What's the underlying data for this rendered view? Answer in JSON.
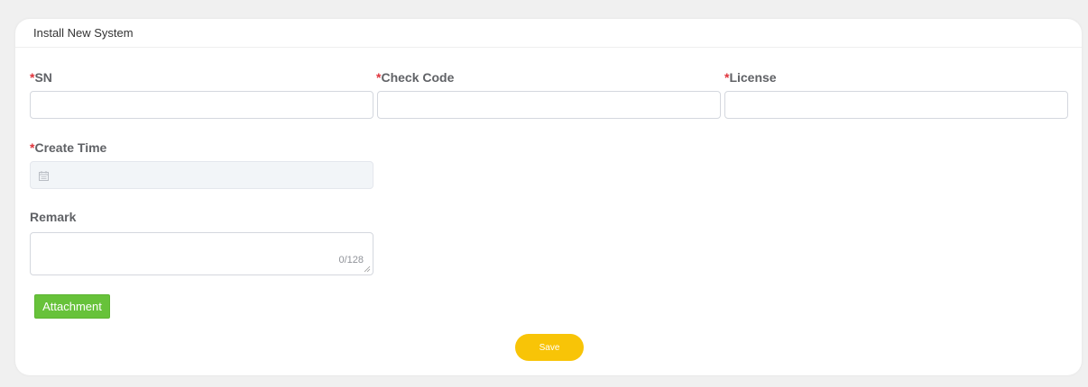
{
  "form": {
    "title": "Install New System",
    "required_mark": "*",
    "fields": {
      "sn": {
        "label": "SN",
        "value": ""
      },
      "check_code": {
        "label": "Check Code",
        "value": ""
      },
      "license": {
        "label": "License",
        "value": ""
      },
      "create_time": {
        "label": "Create Time",
        "value": "",
        "icon": "calendar-icon"
      },
      "remark": {
        "label": "Remark",
        "value": "",
        "counter": "0/128"
      }
    },
    "attachment_label": "Attachment",
    "save_label": "Save"
  },
  "colors": {
    "required": "#e0343c",
    "attachment": "#67c23a",
    "save": "#f8c407",
    "disabled_bg": "#f2f5f8"
  }
}
